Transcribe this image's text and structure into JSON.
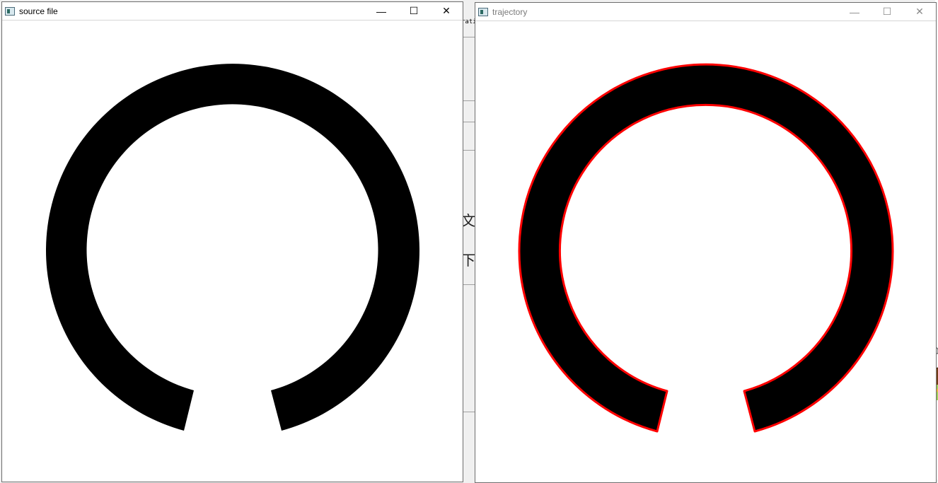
{
  "windows": {
    "source": {
      "title": "source file",
      "controls": {
        "minimize": "—",
        "maximize": "☐",
        "close": "✕"
      }
    },
    "trajectory": {
      "title": "trajectory",
      "controls": {
        "minimize": "—",
        "maximize": "☐",
        "close": "✕"
      }
    }
  },
  "background": {
    "snippet": "rati",
    "char1": "文",
    "char2": "下"
  },
  "colors": {
    "shape_fill": "#000000",
    "trajectory_outline": "#ff0000",
    "canvas_bg": "#ffffff"
  },
  "icons": [
    "window-app-icon",
    "minimize-icon",
    "maximize-icon",
    "close-icon"
  ]
}
